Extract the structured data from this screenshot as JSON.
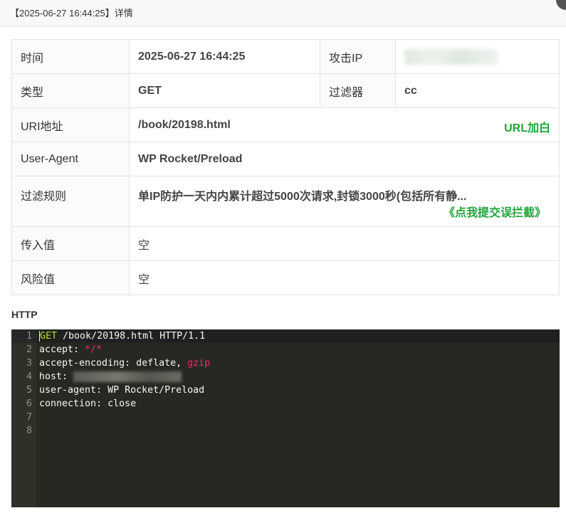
{
  "dialog": {
    "title": "【2025-06-27 16:44:25】详情"
  },
  "details": {
    "time_label": "时间",
    "time_value": "2025-06-27 16:44:25",
    "ip_label": "攻击IP",
    "type_label": "类型",
    "type_value": "GET",
    "filter_label": "过滤器",
    "filter_value": "cc",
    "uri_label": "URI地址",
    "uri_value": "/book/20198.html",
    "uri_whitelist_link": "URL加白",
    "ua_label": "User-Agent",
    "ua_value": "WP Rocket/Preload",
    "rule_label": "过滤规则",
    "rule_value": "单IP防护一天内内累计超过5000次请求,封锁3000秒(包括所有静...",
    "report_link": "《点我提交误拦截》",
    "input_label": "传入值",
    "input_value": "空",
    "risk_label": "风险值",
    "risk_value": "空"
  },
  "http": {
    "section_title": "HTTP",
    "line_numbers": [
      "1",
      "2",
      "3",
      "4",
      "5",
      "6",
      "7",
      "8"
    ],
    "lines": {
      "l1_method": "GET",
      "l1_rest": " /book/20198.html HTTP/1.1",
      "l2_key": "accept: ",
      "l2_value": "*/*",
      "l3_key": "accept-encoding: deflate, ",
      "l3_value": "gzip",
      "l4_key": "host: ",
      "l5": "user-agent: WP Rocket/Preload",
      "l6": "connection: close"
    }
  },
  "colors": {
    "accent_green": "#20a53a",
    "editor_bg": "#272822",
    "keyword": "#a6e22e",
    "string": "#f92672"
  }
}
